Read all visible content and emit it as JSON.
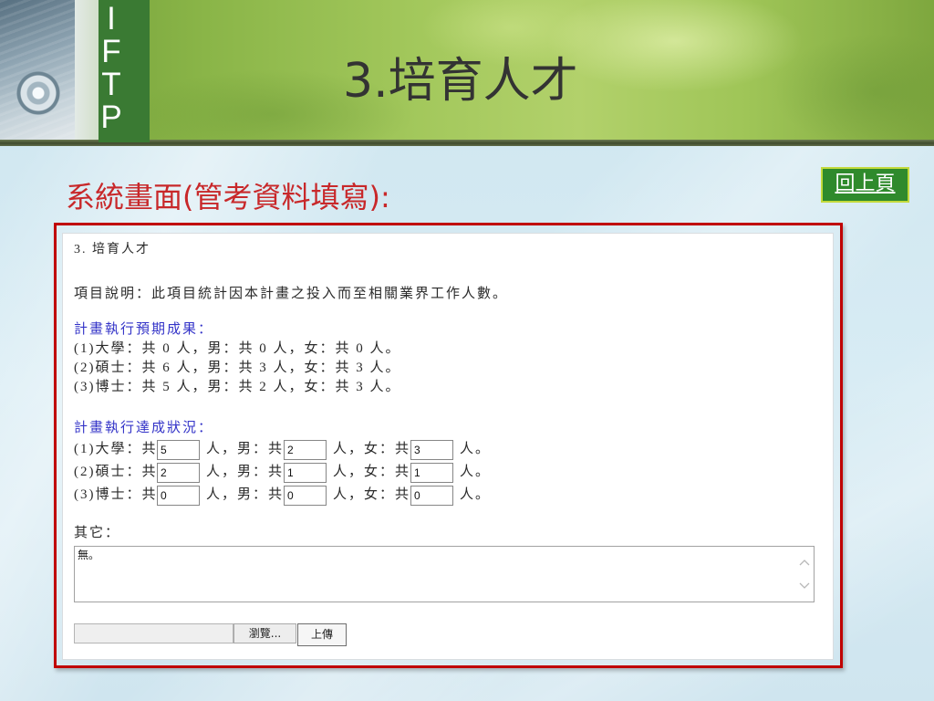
{
  "slide": {
    "side_letters": [
      "I",
      "F",
      "T",
      "P"
    ],
    "title": "3.培育人才",
    "subtitle": "系統畫面(管考資料填寫):",
    "back_button": "回上頁"
  },
  "form": {
    "section_title": "3. 培育人才",
    "description": "項目說明：此項目統計因本計畫之投入而至相關業界工作人數。",
    "expected": {
      "heading": "計畫執行預期成果：",
      "lines": [
        "(1)大學：共 0 人，男：共 0 人，女：共 0 人。",
        "(2)碩士：共 6 人，男：共 3 人，女：共 3 人。",
        "(3)博士：共 5 人，男：共 2 人，女：共 3 人。"
      ]
    },
    "achieved": {
      "heading": "計畫執行達成狀況：",
      "rows": [
        {
          "label": "(1)大學：共",
          "total": "5",
          "male_label": "人，男：共",
          "male": "2",
          "female_label": "人，女：共",
          "female": "3",
          "end": "人。"
        },
        {
          "label": "(2)碩士：共",
          "total": "2",
          "male_label": "人，男：共",
          "male": "1",
          "female_label": "人，女：共",
          "female": "1",
          "end": "人。"
        },
        {
          "label": "(3)博士：共",
          "total": "0",
          "male_label": "人，男：共",
          "male": "0",
          "female_label": "人，女：共",
          "female": "0",
          "end": "人。"
        }
      ]
    },
    "other": {
      "label": "其它：",
      "value": "無。"
    },
    "upload": {
      "browse": "瀏覽...",
      "submit": "上傳"
    }
  },
  "icons": {
    "scroll_up": "chevron-up-icon",
    "scroll_down": "chevron-down-icon"
  },
  "colors": {
    "title_red": "#c8282a",
    "heading_blue": "#3434c8",
    "frame_red": "#c00000",
    "button_green": "#2f8a2c",
    "letter_bar_green": "#3a7a33"
  }
}
